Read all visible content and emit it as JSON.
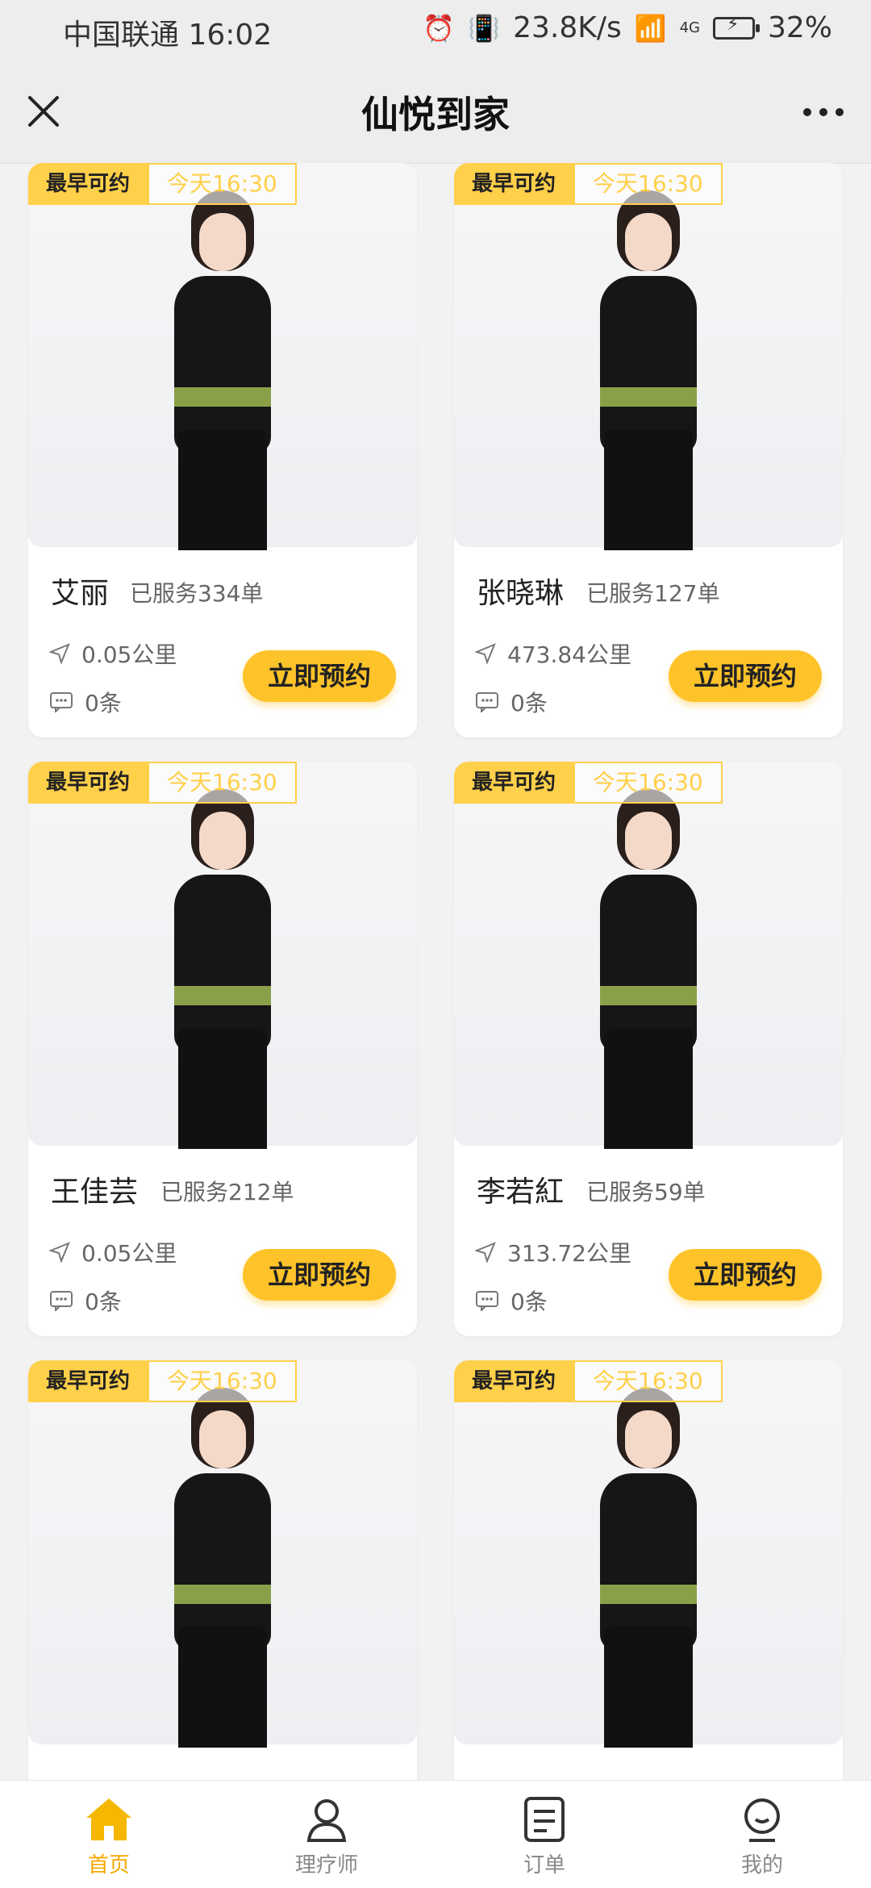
{
  "status_bar": {
    "carrier_time": "中国联通 16:02",
    "net_speed": "23.8K/s",
    "signal": "4G",
    "battery": "32%"
  },
  "header": {
    "title": "仙悦到家"
  },
  "cards": [
    {
      "badge_label": "最早可约",
      "badge_time": "今天16:30",
      "name": "艾丽",
      "served": "已服务334单",
      "distance": "0.05公里",
      "comments": "0条",
      "book_label": "立即预约"
    },
    {
      "badge_label": "最早可约",
      "badge_time": "今天16:30",
      "name": "张晓琳",
      "served": "已服务127单",
      "distance": "473.84公里",
      "comments": "0条",
      "book_label": "立即预约"
    },
    {
      "badge_label": "最早可约",
      "badge_time": "今天16:30",
      "name": "王佳芸",
      "served": "已服务212单",
      "distance": "0.05公里",
      "comments": "0条",
      "book_label": "立即预约"
    },
    {
      "badge_label": "最早可约",
      "badge_time": "今天16:30",
      "name": "李若紅",
      "served": "已服务59单",
      "distance": "313.72公里",
      "comments": "0条",
      "book_label": "立即预约"
    },
    {
      "badge_label": "最早可约",
      "badge_time": "今天16:30"
    },
    {
      "badge_label": "最早可约",
      "badge_time": "今天16:30"
    }
  ],
  "tabs": [
    {
      "label": "首页",
      "icon": "home-icon",
      "active": true
    },
    {
      "label": "理疗师",
      "icon": "person-icon",
      "active": false
    },
    {
      "label": "订单",
      "icon": "order-icon",
      "active": false
    },
    {
      "label": "我的",
      "icon": "profile-icon",
      "active": false
    }
  ],
  "colors": {
    "accent": "#ffc32a",
    "active_tab": "#f5a800"
  }
}
